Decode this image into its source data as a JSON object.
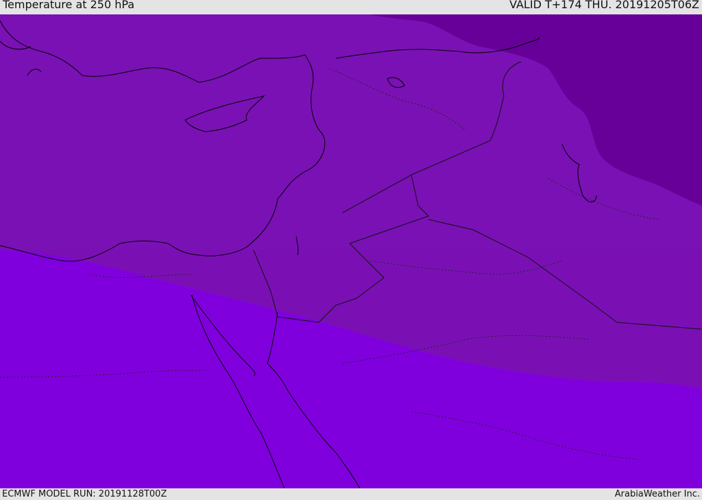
{
  "header": {
    "title": "Temperature at 250 hPa",
    "valid_time": "VALID T+174 THU. 20191205T06Z"
  },
  "footer": {
    "model_run": "ECMWF MODEL RUN: 20191128T00Z",
    "credit": "ArabiaWeather Inc."
  },
  "colors": {
    "zone_cold": "#660099",
    "zone_mid": "#7a10b4",
    "zone_warm": "#8000dd",
    "coastline": "#000000",
    "border": "#1a0030"
  }
}
